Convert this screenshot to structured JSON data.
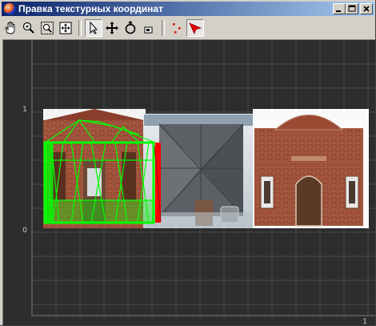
{
  "window": {
    "title": "Правка текстурных координат",
    "minimize": "_",
    "maximize": "□",
    "close": "×"
  },
  "toolbar": {
    "tools": [
      {
        "name": "hand-pan-icon"
      },
      {
        "name": "zoom-icon"
      },
      {
        "name": "zoom-region-icon"
      },
      {
        "name": "zoom-extents-icon"
      },
      {
        "name": "select-arrow-icon",
        "pressed": true
      },
      {
        "name": "move-icon"
      },
      {
        "name": "rotate-icon"
      },
      {
        "name": "scale-icon"
      },
      {
        "name": "vertex-mode-icon"
      },
      {
        "name": "red-select-arrow-icon"
      }
    ]
  },
  "uv_view": {
    "labels": {
      "v1": "1",
      "v0": "0",
      "u1": "1"
    },
    "colors": {
      "background": "#2d2d2d",
      "grid": "#4a4a4a",
      "uv_wire": "#00ff00",
      "seam": "#ff0000"
    }
  }
}
